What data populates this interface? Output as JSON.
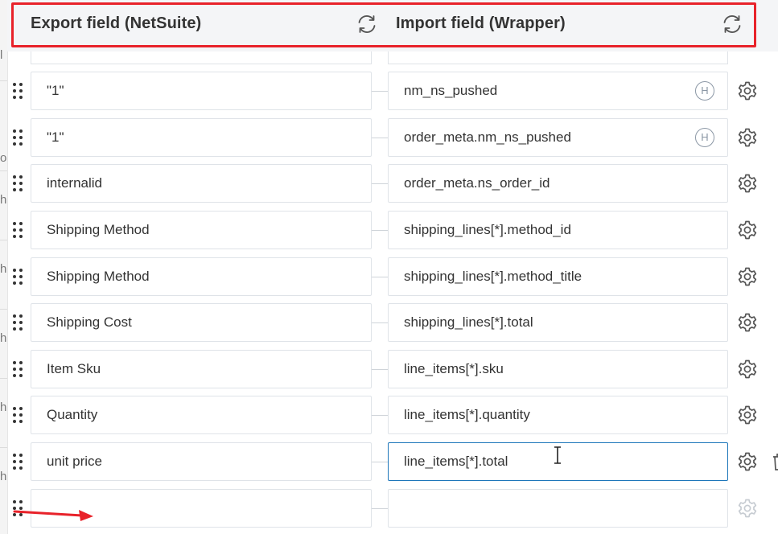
{
  "header": {
    "export_title": "Export field (NetSuite)",
    "import_title": "Import field (Wrapper)",
    "export_refresh_icon": "refresh-icon",
    "import_refresh_icon": "refresh-icon"
  },
  "left_gutter": {
    "fragments": [
      "l",
      "o",
      "h",
      "h",
      "h",
      "h",
      "h"
    ]
  },
  "rows": [
    {
      "export": "\"1\"",
      "import": "nm_ns_pushed",
      "badge": "H"
    },
    {
      "export": "\"1\"",
      "import": "order_meta.nm_ns_pushed",
      "badge": "H"
    },
    {
      "export": "internalid",
      "import": "order_meta.ns_order_id"
    },
    {
      "export": "Shipping Method",
      "import": "shipping_lines[*].method_id"
    },
    {
      "export": "Shipping Method",
      "import": "shipping_lines[*].method_title"
    },
    {
      "export": "Shipping Cost",
      "import": "shipping_lines[*].total"
    },
    {
      "export": "Item Sku",
      "import": "line_items[*].sku"
    },
    {
      "export": "Quantity",
      "import": "line_items[*].quantity"
    },
    {
      "export": "unit price",
      "import": "line_items[*].total"
    },
    {
      "export": "",
      "import": ""
    }
  ],
  "colors": {
    "highlight_outline": "#e8222a",
    "active_border": "#1d76ba",
    "header_bg": "#f4f5f7",
    "field_border": "#dfe3e8",
    "icon_gray": "#8b97a5"
  }
}
